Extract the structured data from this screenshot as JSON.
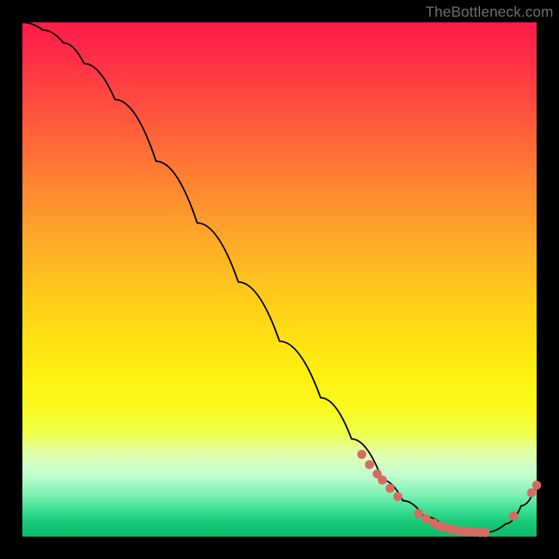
{
  "watermark": "TheBottleneck.com",
  "chart_data": {
    "type": "line",
    "title": "",
    "xlabel": "",
    "ylabel": "",
    "xlim": [
      0,
      100
    ],
    "ylim": [
      0,
      100
    ],
    "curve": {
      "name": "bottleneck-curve",
      "x": [
        0,
        4,
        8,
        12,
        18,
        26,
        34,
        42,
        50,
        58,
        64,
        70,
        74,
        78,
        82,
        86,
        90,
        94,
        97,
        100
      ],
      "y": [
        100,
        98.5,
        96,
        92,
        85,
        73,
        61,
        49.5,
        38,
        27,
        19,
        11,
        7,
        4,
        2,
        1,
        0.8,
        2.5,
        6,
        10
      ]
    },
    "markers": {
      "name": "highlight-points",
      "color": "#d86a63",
      "points": [
        {
          "x": 66,
          "y": 16
        },
        {
          "x": 67.5,
          "y": 14
        },
        {
          "x": 69,
          "y": 12.2
        },
        {
          "x": 70,
          "y": 11
        },
        {
          "x": 71.5,
          "y": 9.4
        },
        {
          "x": 73,
          "y": 7.8
        },
        {
          "x": 77,
          "y": 4.5
        },
        {
          "x": 78.5,
          "y": 3.5
        },
        {
          "x": 80,
          "y": 2.6
        },
        {
          "x": 81,
          "y": 2.1
        },
        {
          "x": 82,
          "y": 1.8
        },
        {
          "x": 83,
          "y": 1.5
        },
        {
          "x": 84,
          "y": 1.3
        },
        {
          "x": 85,
          "y": 1.1
        },
        {
          "x": 86,
          "y": 1.0
        },
        {
          "x": 87,
          "y": 0.9
        },
        {
          "x": 88,
          "y": 0.85
        },
        {
          "x": 89,
          "y": 0.8
        },
        {
          "x": 90,
          "y": 0.8
        },
        {
          "x": 95.5,
          "y": 4
        },
        {
          "x": 99,
          "y": 8.5
        },
        {
          "x": 100,
          "y": 10
        }
      ]
    }
  }
}
